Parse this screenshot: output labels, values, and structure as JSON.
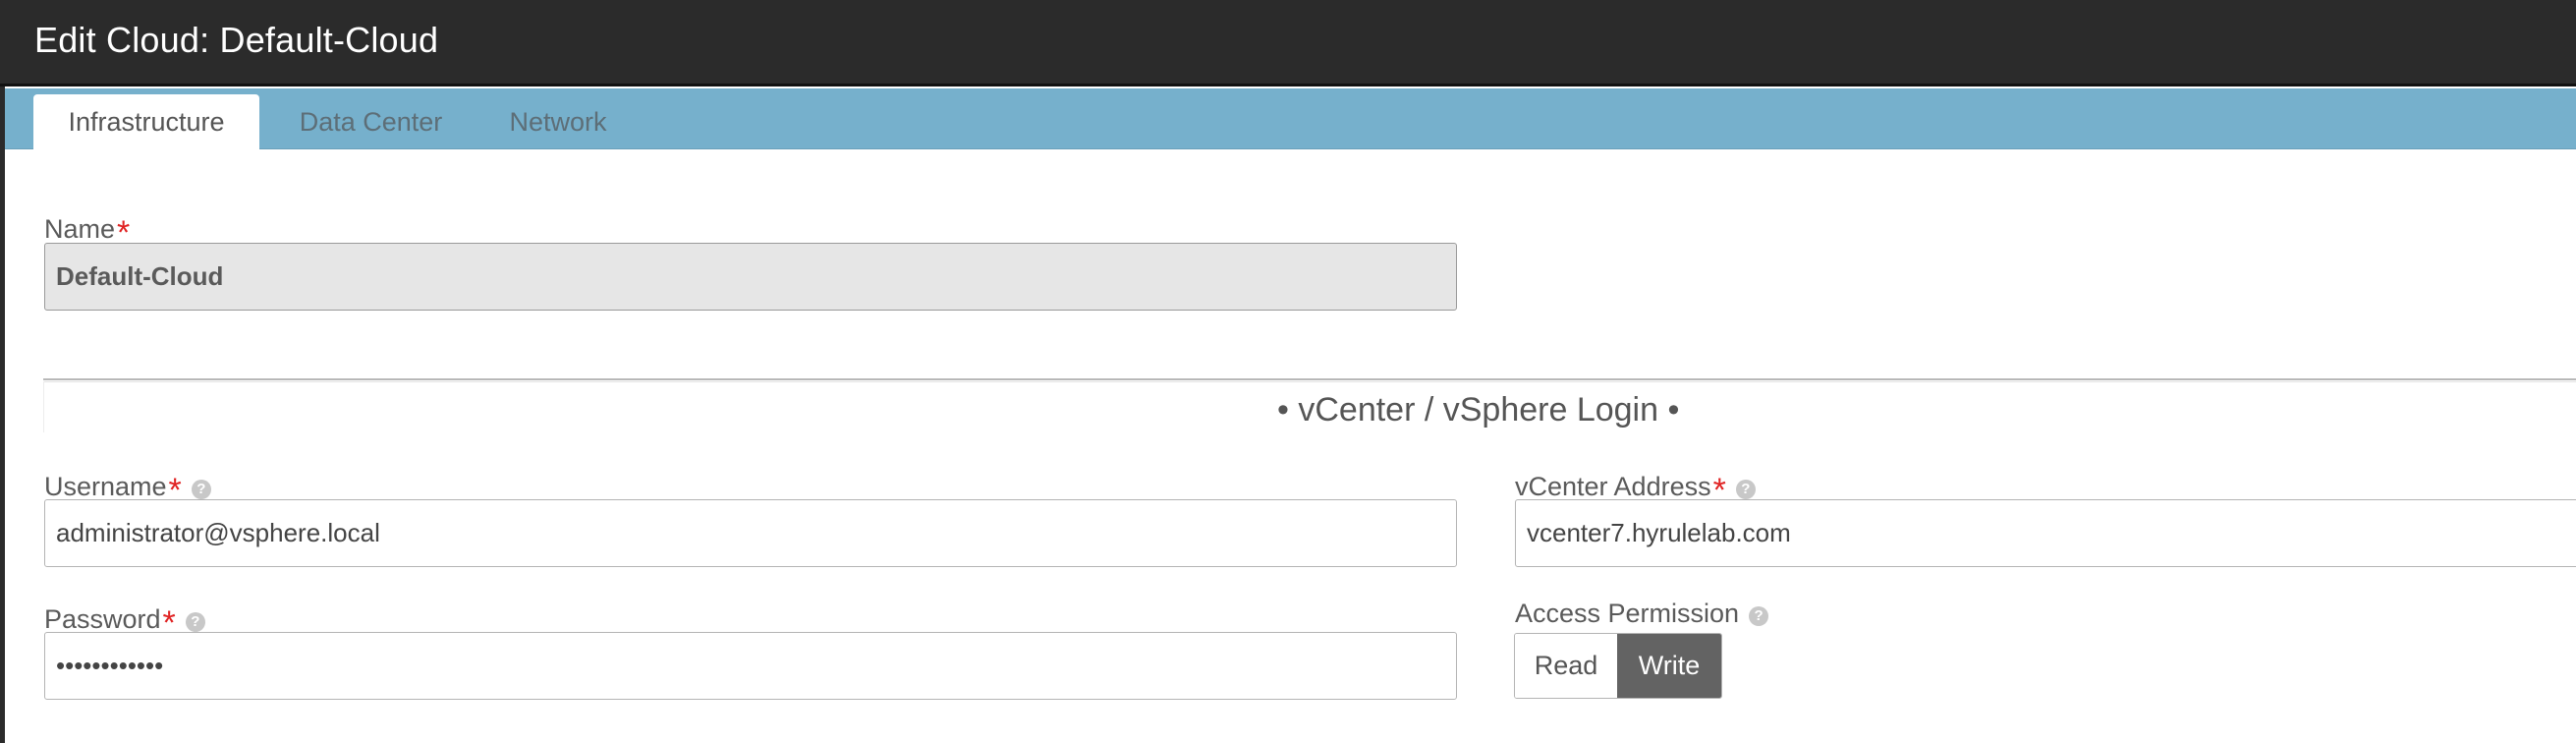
{
  "window": {
    "title": "Edit Cloud: Default-Cloud"
  },
  "tabs": [
    {
      "label": "Infrastructure",
      "active": true
    },
    {
      "label": "Data Center",
      "active": false
    },
    {
      "label": "Network",
      "active": false
    }
  ],
  "form": {
    "name": {
      "label": "Name",
      "value": "Default-Cloud",
      "required": true,
      "disabled": true
    },
    "section_title": "• vCenter / vSphere Login •",
    "username": {
      "label": "Username",
      "value": "administrator@vsphere.local",
      "required": true
    },
    "password": {
      "label": "Password",
      "value": "••••••••••••",
      "required": true
    },
    "vcenter_address": {
      "label": "vCenter Address",
      "value": "vcenter7.hyrulelab.com",
      "required": true
    },
    "access_permission": {
      "label": "Access Permission",
      "options": [
        "Read",
        "Write"
      ],
      "selected": "Write"
    },
    "required_marker": "*",
    "help_glyph": "?"
  },
  "colors": {
    "titlebar": "#2b2b2b",
    "tabbar": "#76b0cc",
    "required": "#e02323",
    "selected_segment": "#636363"
  }
}
